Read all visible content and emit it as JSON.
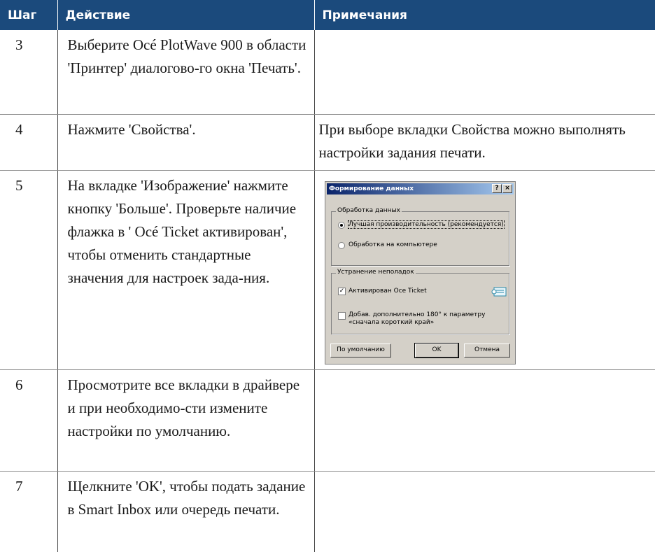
{
  "table": {
    "headers": {
      "step": "Шаг",
      "action": "Действие",
      "notes": "Примечания"
    },
    "rows": [
      {
        "step": "3",
        "action": "Выберите Océ PlotWave 900 в области 'Принтер' диалогово-го окна 'Печать'.",
        "note": ""
      },
      {
        "step": "4",
        "action": "Нажмите 'Свойства'.",
        "note": "При выборе вкладки Свойства можно выполнять настройки задания печати."
      },
      {
        "step": "5",
        "action": "На вкладке 'Изображение' нажмите кнопку 'Больше'. Проверьте наличие флажка в ' Océ Ticket активирован', чтобы отменить стандартные значения для настроек зада-ния.",
        "note": ""
      },
      {
        "step": "6",
        "action": "Просмотрите все вкладки в драйвере и при необходимо-сти измените настройки по умолчанию.",
        "note": ""
      },
      {
        "step": "7",
        "action": "Щелкните 'OK', чтобы подать задание в Smart Inbox или очередь печати.",
        "note": ""
      }
    ]
  },
  "dialog": {
    "title": "Формирование данных",
    "help_label": "?",
    "close_label": "×",
    "group1_title": "Обработка данных",
    "option1": "Лучшая производительность (рекомендуется)",
    "option2": "Обработка на компьютере",
    "group2_title": "Устранение неполадок",
    "check1": "Активирован Oce Ticket",
    "check2_line1": "Добав. дополнительно 180° к параметру",
    "check2_line2": "«сначала короткий край»",
    "btn_default": "По умолчанию",
    "btn_ok": "OK",
    "btn_cancel": "Отмена",
    "check_mark": "✓"
  }
}
